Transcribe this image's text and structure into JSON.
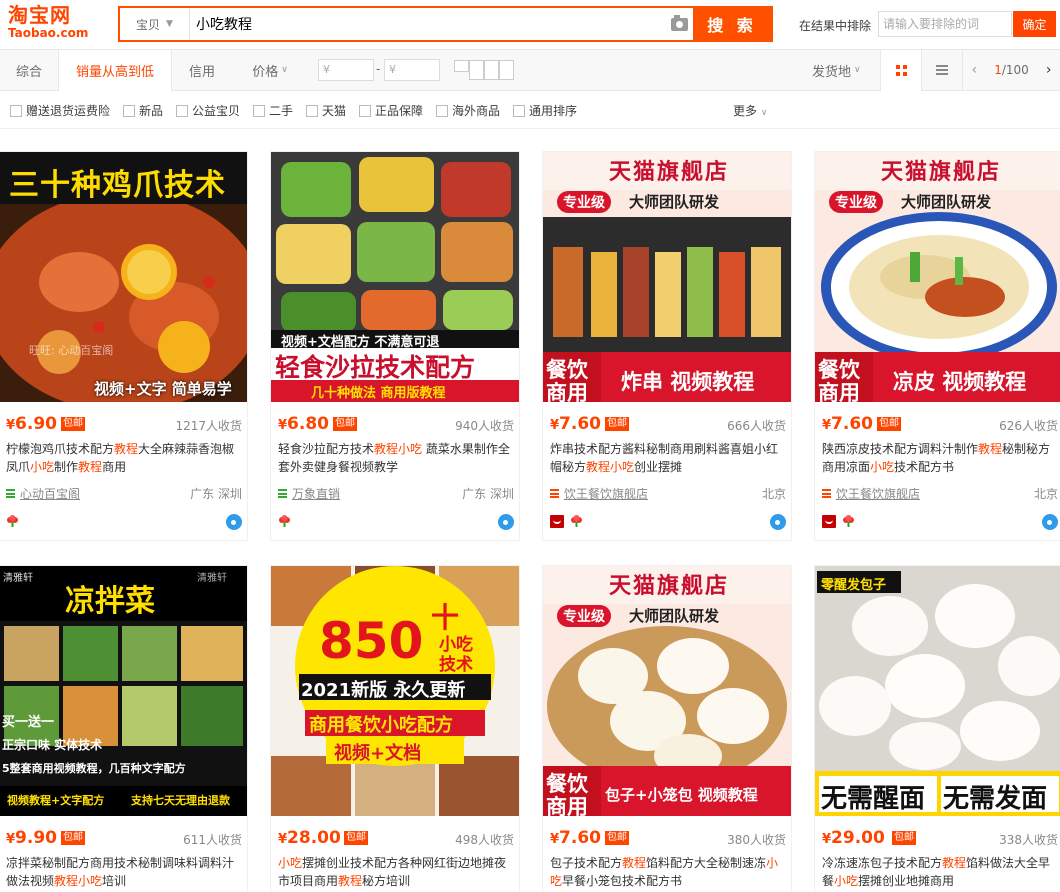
{
  "header": {
    "logo_cn": "淘宝网",
    "logo_en": "Taobao.com",
    "scope": "宝贝",
    "query": "小吃教程",
    "search_label": "搜 索",
    "exclude_label": "在结果中排除",
    "exclude_placeholder": "请输入要排除的词",
    "exclude_button": "确定"
  },
  "sortbar": {
    "tabs": [
      "综合",
      "销量从高到低",
      "信用",
      "价格"
    ],
    "price_min_placeholder": "¥",
    "price_max_placeholder": "¥",
    "price_dash": "-",
    "ship_from": "发货地",
    "page_current": "1",
    "page_total": "/100"
  },
  "filters": [
    "赠送退货运费险",
    "新品",
    "公益宝贝",
    "二手",
    "天猫",
    "正品保障",
    "海外商品",
    "通用排序"
  ],
  "more_label": "更多",
  "colors": {
    "accent": "#ff4400",
    "brand_orange": "#ff5000"
  },
  "products": [
    {
      "image_text": [
        "三十种鸡爪技术",
        "视频+文字 简单易学",
        "旺旺: 心动百宝阁"
      ],
      "price": "6.90",
      "yen": "¥",
      "baoyou": "包邮",
      "sold": "1217人收货",
      "title_parts": [
        "柠檬泡鸡爪技术配方",
        "教程",
        "大全麻辣蒜香泡椒凤爪",
        "小吃",
        "制作",
        "教程",
        "商用"
      ],
      "shop": "心动百宝阁",
      "location": "广东 深圳",
      "tmall": false
    },
    {
      "image_text": [
        "视频+文档配方 不满意可退",
        "轻食沙拉技术配方",
        "几十种做法 商用版教程"
      ],
      "price": "6.80",
      "yen": "¥",
      "baoyou": "包邮",
      "sold": "940人收货",
      "title_parts": [
        "轻食沙拉配方技术",
        "教程",
        "",
        "小吃",
        " 蔬菜水果制作全套外卖健身餐视频教学"
      ],
      "shop": "万象直销",
      "location": "广东 深圳",
      "tmall": false
    },
    {
      "image_text": [
        "天猫旗舰店",
        "专业级",
        "大师团队研发",
        "餐饮",
        "商用",
        "炸串 视频教程"
      ],
      "price": "7.60",
      "yen": "¥",
      "baoyou": "包邮",
      "sold": "666人收货",
      "title_parts": [
        "炸串技术配方酱料秘制商用刷料酱喜姐小红帽秘方",
        "教程",
        "",
        "小吃",
        "创业摆摊"
      ],
      "shop": "饮王餐饮旗舰店",
      "location": "北京",
      "tmall": true
    },
    {
      "image_text": [
        "天猫旗舰店",
        "专业级",
        "大师团队研发",
        "餐饮",
        "商用",
        "凉皮 视频教程"
      ],
      "price": "7.60",
      "yen": "¥",
      "baoyou": "包邮",
      "sold": "626人收货",
      "title_parts": [
        "陕西凉皮技术配方调料汁制作",
        "教程",
        "秘制秘方商用凉面",
        "小吃",
        "技术配方书"
      ],
      "shop": "饮王餐饮旗舰店",
      "location": "北京",
      "tmall": true
    },
    {
      "image_text": [
        "清雅轩",
        "凉拌菜",
        "清雅轩",
        "买一送一",
        "正宗口味 实体技术",
        "5整套商用视频教程，几百种文字配方",
        "视频教程+文字配方",
        "支持七天无理由退款"
      ],
      "price": "9.90",
      "yen": "¥",
      "baoyou": "包邮",
      "sold": "611人收货",
      "title_parts": [
        "凉拌菜秘制配方商用技术秘制调味料调料汁做法视频",
        "教程",
        "",
        "小吃",
        "培训"
      ]
    },
    {
      "image_text": [
        "850",
        "十",
        "小吃",
        "技术",
        "2021新版 永久更新",
        "商用餐饮小吃配方",
        "视频+文档"
      ],
      "price": "28.00",
      "yen": "¥",
      "baoyou": "包邮",
      "sold": "498人收货",
      "title_parts": [
        "",
        "小吃",
        "摆摊创业技术配方各种网红街边地摊夜市项目商用",
        "教程",
        "秘方培训"
      ]
    },
    {
      "image_text": [
        "天猫旗舰店",
        "专业级",
        "大师团队研发",
        "餐饮",
        "商用",
        "包子+小笼包 视频教程"
      ],
      "price": "7.60",
      "yen": "¥",
      "baoyou": "包邮",
      "sold": "380人收货",
      "title_parts": [
        "包子技术配方",
        "教程",
        "馅料配方大全秘制速冻",
        "小吃",
        "早餐小笼包技术配方书"
      ]
    },
    {
      "image_text": [
        "零醒发包子",
        "无需醒面",
        "无需发面"
      ],
      "price": "29.00",
      "yen": "¥",
      "baoyou": "包邮",
      "sold": "338人收货",
      "title_parts": [
        "冷冻速冻包子技术配方",
        "教程",
        "馅料做法大全早餐",
        "小吃",
        "摆摊创业地摊商用"
      ]
    }
  ]
}
